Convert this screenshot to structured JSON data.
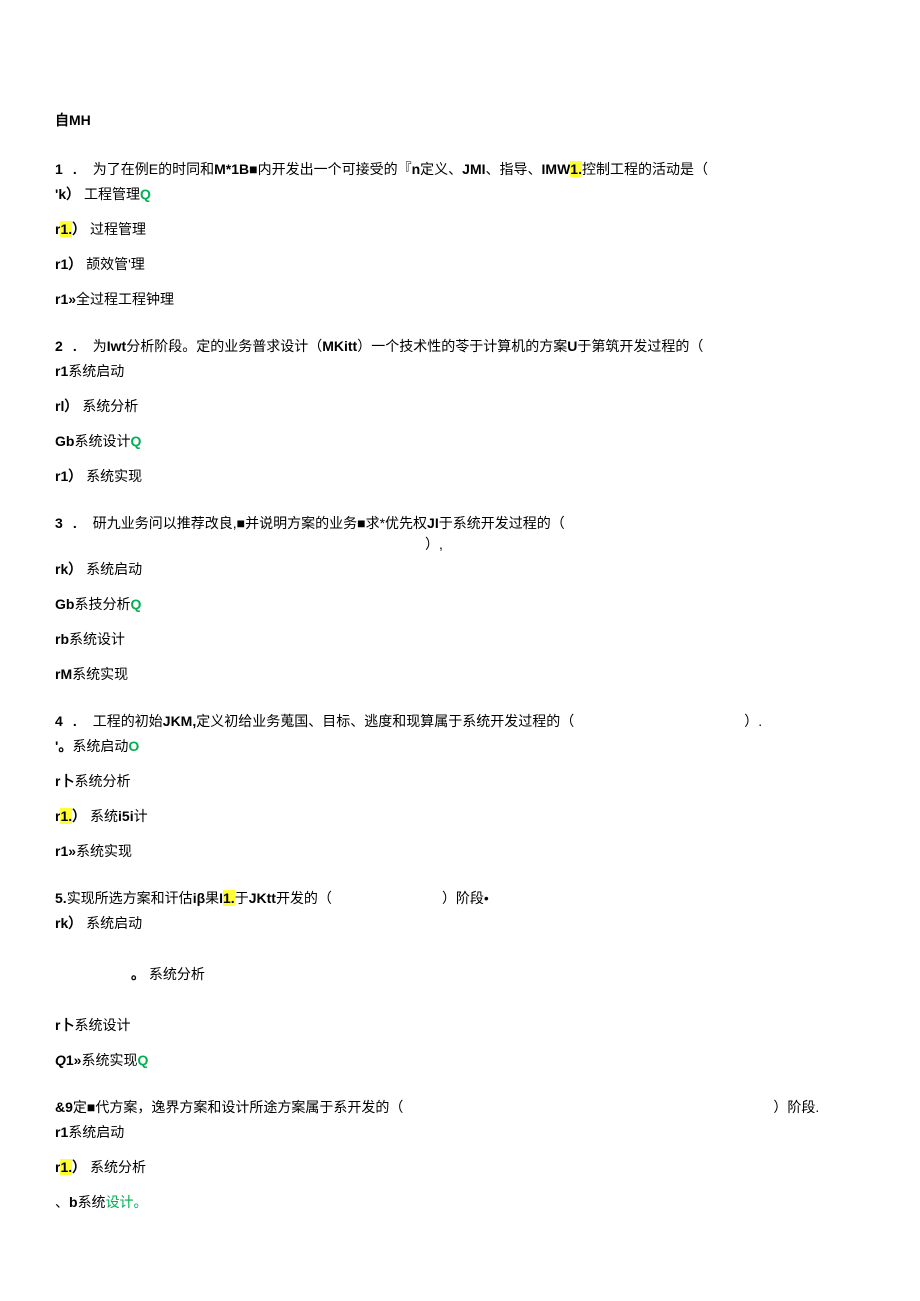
{
  "title": "自MH",
  "q1": {
    "stem_a": "1",
    "stem_dot": ".",
    "stem_b": "为了在例E的时同和",
    "stem_c": "M*1B",
    "stem_d": "■内开发出一个可接受的『",
    "stem_e": "n",
    "stem_f": "定义、",
    "stem_g": "JMI",
    "stem_h": "、指导、",
    "stem_i": "IMW",
    "stem_j": "1.",
    "stem_k": "控制工程的活动是（",
    "a_label": "'k）",
    "a_text": "工程管理",
    "a_mark": "Q",
    "b_label_pre": "r",
    "b_label_hl": "1.",
    "b_label_post": "）",
    "b_text": "过程管理",
    "c_label": "r1）",
    "c_text": "颉效管'理",
    "d_label": "r1»",
    "d_text": "全过程工程钟理"
  },
  "q2": {
    "stem_a": "2",
    "stem_dot": ".",
    "stem_b": "为",
    "stem_c": "Iwt",
    "stem_d": "分析阶段。定的业务普求设计（",
    "stem_e": "MKitt",
    "stem_f": "）一个技术性的苓于计算机的方案",
    "stem_g": "U",
    "stem_h": "于第筑开发过程的（",
    "a_label": "r1",
    "a_text": "系统启动",
    "b_label": "rl）",
    "b_text": "系统分析",
    "c_label": "Gb",
    "c_text": "系统设计",
    "c_mark": "Q",
    "d_label": "r1）",
    "d_text": "系统实现"
  },
  "q3": {
    "stem_a": "3",
    "stem_dot": ".",
    "stem_b": "研九业务问以推荐改良,■并说明方案的业务■求*优先权",
    "stem_c": "JI",
    "stem_d": "于系统开发过程的（",
    "stem_tail": "）,",
    "a_label": "rk）",
    "a_text": "系统启动",
    "b_label": "Gb",
    "b_text": "系技分析",
    "b_mark": "Q",
    "c_label": "rb",
    "c_text": "系统设计",
    "d_label": "rM",
    "d_text": "系统实现"
  },
  "q4": {
    "stem_a": "4",
    "stem_dot": ".",
    "stem_b": "工程的初始",
    "stem_c": "JKM,",
    "stem_d": "定义初给业务蒐国、目标、逃度和现算属于系统开发过程的（",
    "stem_tail": "）.",
    "a_label": "'。",
    "a_text": "系统启动",
    "a_mark": "O",
    "b_label": "r卜",
    "b_text": "系统分析",
    "c_label_pre": "r",
    "c_label_hl": "1.",
    "c_label_post": "）",
    "c_text": "系统",
    "c_text2": "i5i",
    "c_text3": "计",
    "d_label": "r1»",
    "d_text": "系统实现"
  },
  "q5": {
    "stem_a": "5.",
    "stem_b": "实现所选方案和讦估",
    "stem_c": "iβ",
    "stem_d": "果",
    "stem_e": "I",
    "stem_f": "1.",
    "stem_g": "于",
    "stem_h": "JKtt",
    "stem_i": "开发的（",
    "stem_tail": "）阶段•",
    "a_label": "rk）",
    "a_text": "系统启动",
    "b_label": "。",
    "b_text": "系统分析",
    "c_label": "r卜",
    "c_text": "系统设计",
    "d_label_pre": "Q",
    "d_label_post": "1»",
    "d_text": "系统实现",
    "d_mark": "Q"
  },
  "q6": {
    "stem_a": "&9",
    "stem_b": "定■代方案，逸界方案和设计所途方案属于系开发的（",
    "stem_tail": "）阶段.",
    "a_label": "r1",
    "a_text": "系统启动",
    "b_label_pre": "r",
    "b_label_hl": "1.",
    "b_label_post": "）",
    "b_text": "系统分析",
    "c_label": "、",
    "c_text_b": "b",
    "c_text": "系统",
    "c_text_g": "设计。"
  }
}
